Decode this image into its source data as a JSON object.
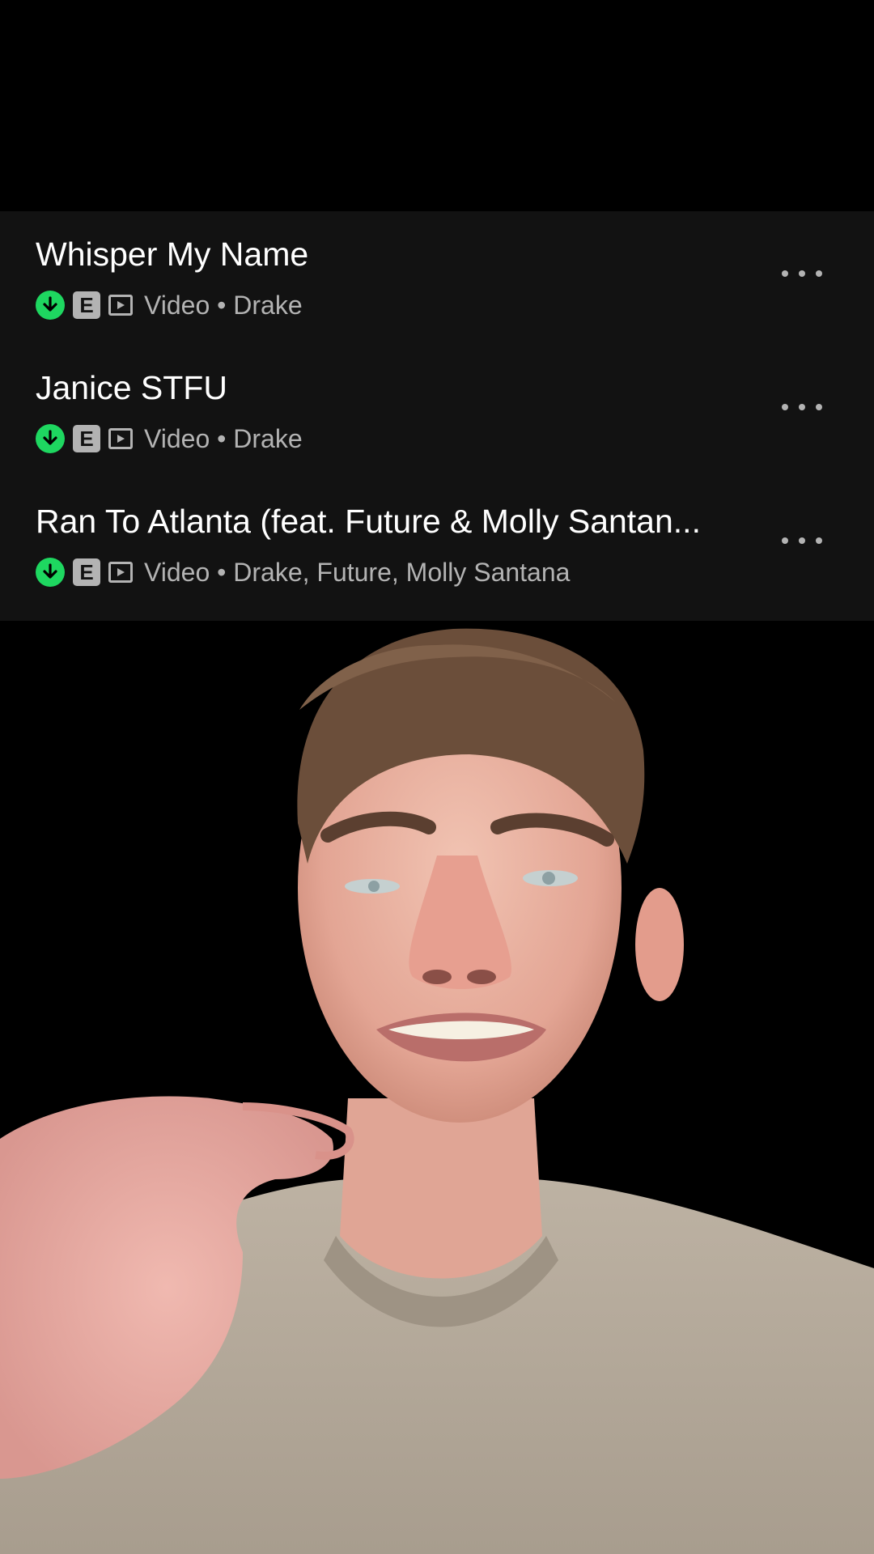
{
  "tracks": [
    {
      "title": "Whisper My Name",
      "badge": "E",
      "type": "Video",
      "separator": "•",
      "artists": "Drake"
    },
    {
      "title": "Janice STFU",
      "badge": "E",
      "type": "Video",
      "separator": "•",
      "artists": "Drake"
    },
    {
      "title": "Ran To Atlanta (feat. Future & Molly Santan...",
      "badge": "E",
      "type": "Video",
      "separator": "•",
      "artists": "Drake, Future, Molly Santana"
    }
  ],
  "colors": {
    "panel_bg": "#121212",
    "accent_green": "#1ed760",
    "subtext": "#b3b3b3",
    "title": "#ffffff"
  },
  "icons": [
    "download-icon",
    "explicit-badge",
    "video-icon",
    "more-options-icon"
  ]
}
